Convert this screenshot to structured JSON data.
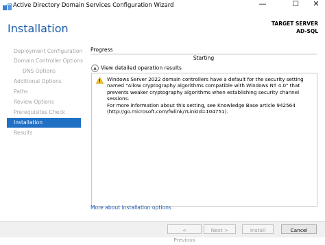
{
  "window": {
    "title": "Active Directory Domain Services Configuration Wizard",
    "minimize_glyph": "—",
    "maximize_glyph": "☐",
    "close_glyph": "✕"
  },
  "header": {
    "page_title": "Installation",
    "target_label": "TARGET SERVER",
    "target_name": "AD-SQL"
  },
  "sidebar": {
    "items": [
      {
        "label": "Deployment Configuration"
      },
      {
        "label": "Domain Controller Options"
      },
      {
        "label": "DNS Options"
      },
      {
        "label": "Additional Options"
      },
      {
        "label": "Paths"
      },
      {
        "label": "Review Options"
      },
      {
        "label": "Prerequisites Check"
      },
      {
        "label": "Installation"
      },
      {
        "label": "Results"
      }
    ],
    "active_index": 7
  },
  "main": {
    "progress_label": "Progress",
    "progress_fraction": 0.0,
    "status_text": "Starting",
    "details_toggle": "View detailed operation results",
    "warning_icon": "warning-icon",
    "warning_message": "Windows Server 2022 domain controllers have a default for the security setting named \"Allow cryptography algorithms compatible with Windows NT 4.0\" that prevents weaker cryptography algorithms when establishing security channel sessions.",
    "warning_more_info": "For more information about this setting, see Knowledge Base article 942564 (http://go.microsoft.com/fwlink/?LinkId=104751).",
    "more_link": "More about installation options"
  },
  "footer": {
    "previous": "< Previous",
    "next": "Next >",
    "install": "Install",
    "cancel": "Cancel"
  },
  "colors": {
    "accent": "#1f6fc5",
    "title_blue": "#1c5aa6",
    "link": "#1f5bb5",
    "disabled_text": "#a6a6a6"
  }
}
